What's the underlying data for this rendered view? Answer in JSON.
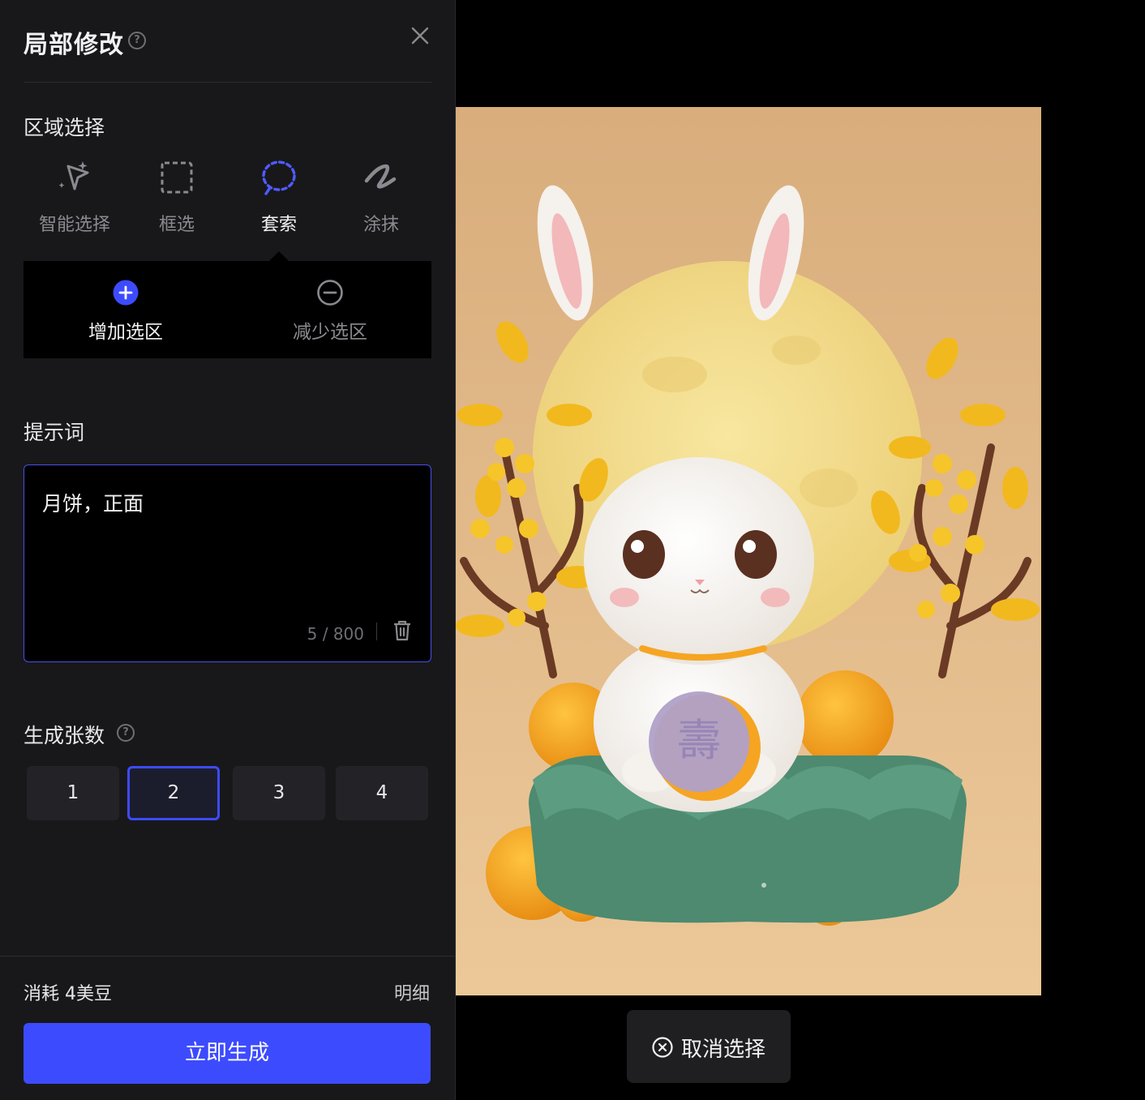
{
  "panel": {
    "title": "局部修改",
    "region_section": {
      "label": "区域选择",
      "tools": [
        {
          "label": "智能选择",
          "icon": "smart-select-icon",
          "active": false
        },
        {
          "label": "框选",
          "icon": "box-select-icon",
          "active": false
        },
        {
          "label": "套索",
          "icon": "lasso-icon",
          "active": true
        },
        {
          "label": "涂抹",
          "icon": "brush-icon",
          "active": false
        }
      ],
      "modes": [
        {
          "label": "增加选区",
          "icon": "plus-circle-icon",
          "active": true
        },
        {
          "label": "减少选区",
          "icon": "minus-circle-icon",
          "active": false
        }
      ]
    },
    "prompt_section": {
      "label": "提示词",
      "value": "月饼，正面",
      "counter": "5 / 800"
    },
    "count_section": {
      "label": "生成张数",
      "options": [
        "1",
        "2",
        "3",
        "4"
      ],
      "selected": "2"
    },
    "footer": {
      "cost": "消耗 4美豆",
      "detail": "明细",
      "generate": "立即生成"
    }
  },
  "canvas": {
    "cancel_selection": "取消选择"
  },
  "colors": {
    "accent": "#3d4bff",
    "panel_bg": "#18181b",
    "image_bg": "#e2b787"
  }
}
